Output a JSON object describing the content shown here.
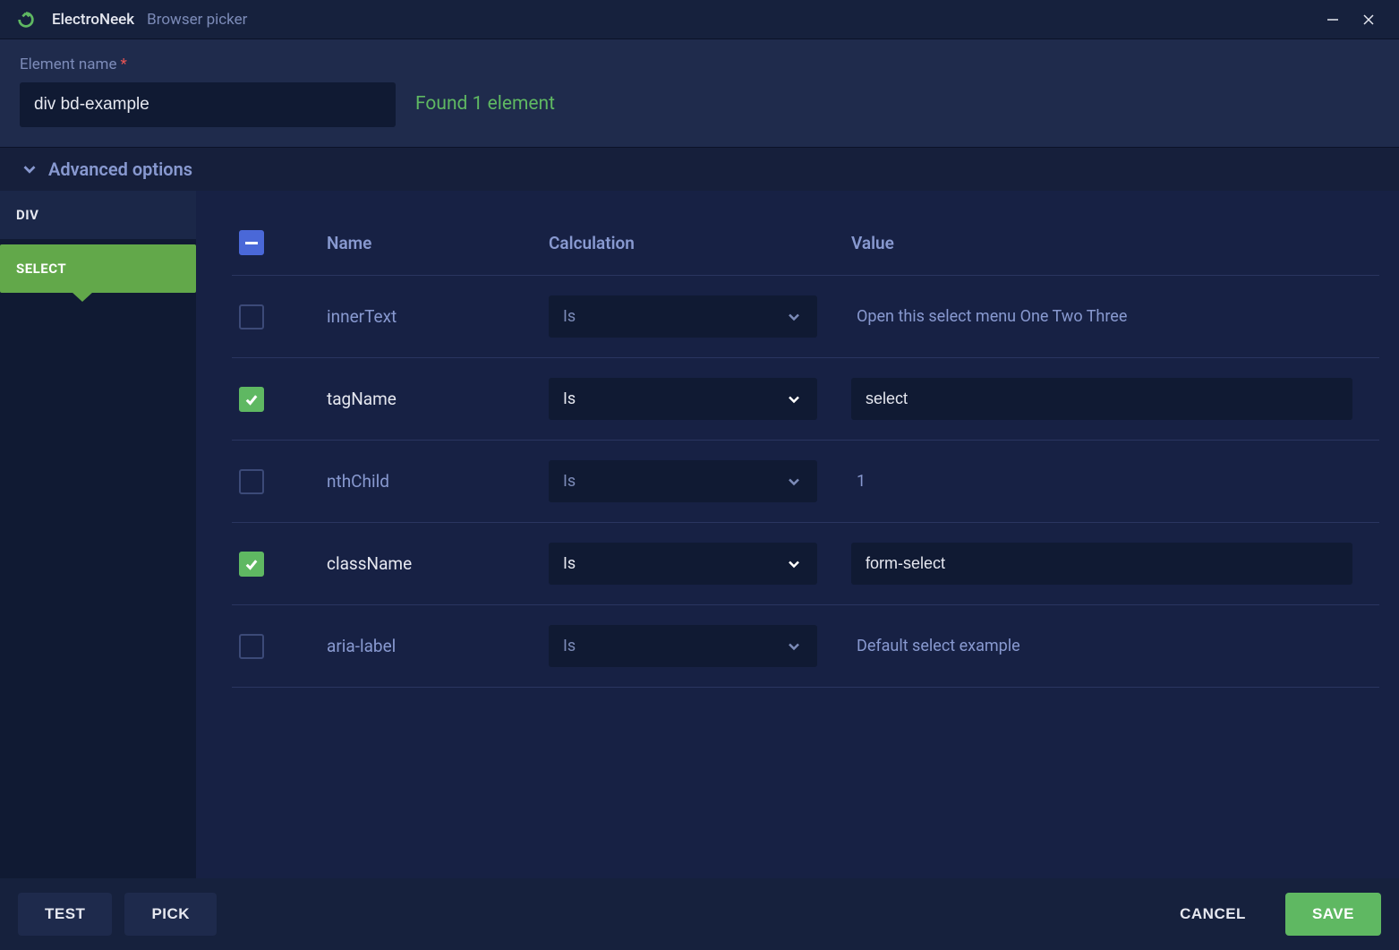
{
  "titlebar": {
    "app_name": "ElectroNeek",
    "window_title": "Browser picker"
  },
  "header": {
    "element_name_label": "Element name",
    "element_name_value": "div bd-example",
    "found_text": "Found 1 element"
  },
  "advanced": {
    "label": "Advanced options"
  },
  "sidebar": {
    "tabs": [
      {
        "label": "DIV",
        "active": false
      },
      {
        "label": "SELECT",
        "active": true
      }
    ]
  },
  "table": {
    "header": {
      "name": "Name",
      "calculation": "Calculation",
      "value": "Value"
    },
    "rows": [
      {
        "checked": false,
        "name": "innerText",
        "calc": "Is",
        "value": "Open this select menu  One  Two  Three"
      },
      {
        "checked": true,
        "name": "tagName",
        "calc": "Is",
        "value": "select"
      },
      {
        "checked": false,
        "name": "nthChild",
        "calc": "Is",
        "value": "1"
      },
      {
        "checked": true,
        "name": "className",
        "calc": "Is",
        "value": "form-select"
      },
      {
        "checked": false,
        "name": "aria-label",
        "calc": "Is",
        "value": "Default select example"
      }
    ]
  },
  "footer": {
    "test": "TEST",
    "pick": "PICK",
    "cancel": "CANCEL",
    "save": "SAVE"
  }
}
